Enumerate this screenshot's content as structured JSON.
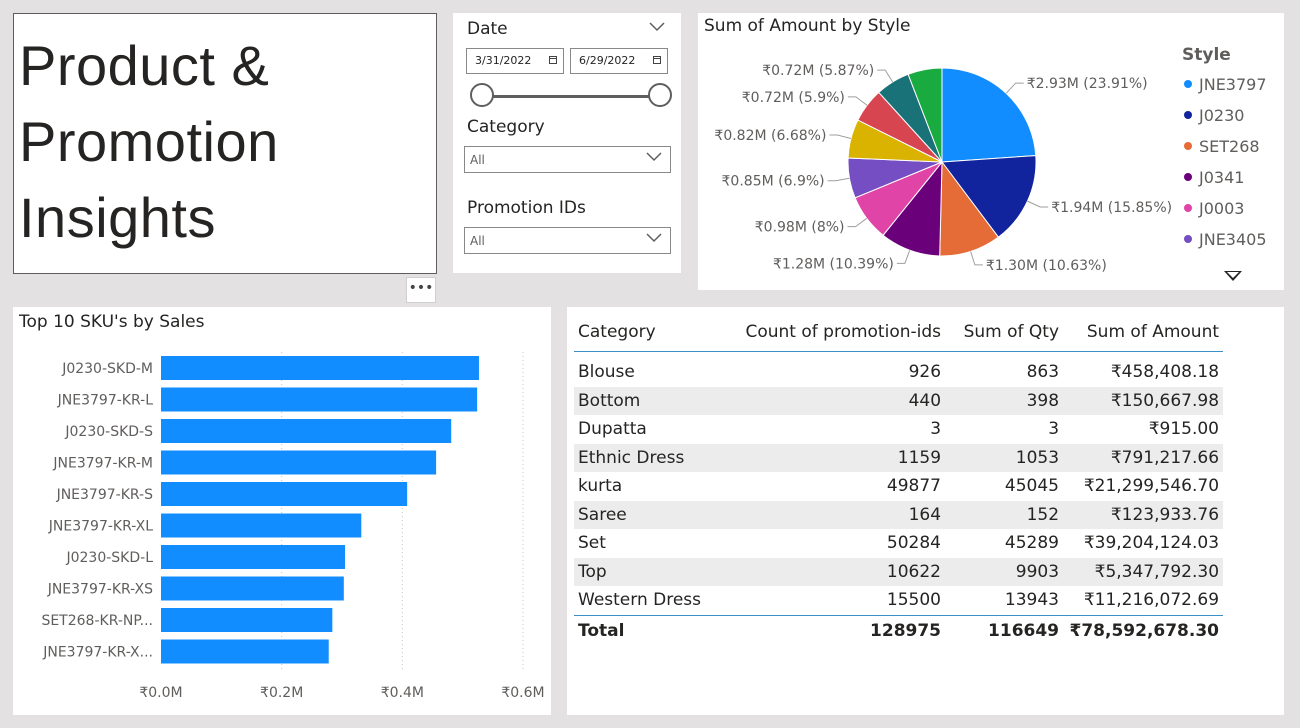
{
  "title_card": {
    "text": "Product  &\nPromotion\nInsights",
    "more_label": "•••"
  },
  "filters": {
    "date": {
      "label": "Date",
      "start": "3/31/2022",
      "end": "6/29/2022"
    },
    "category": {
      "label": "Category",
      "value": "All"
    },
    "promotion": {
      "label": "Promotion IDs",
      "value": "All"
    }
  },
  "pie": {
    "title": "Sum of Amount by Style",
    "legend_title": "Style",
    "legend": [
      {
        "name": "JNE3797",
        "color": "#118dff"
      },
      {
        "name": "J0230",
        "color": "#12239e"
      },
      {
        "name": "SET268",
        "color": "#e66c37"
      },
      {
        "name": "J0341",
        "color": "#6b007b"
      },
      {
        "name": "J0003",
        "color": "#e044a7"
      },
      {
        "name": "JNE3405",
        "color": "#744ec2"
      }
    ]
  },
  "chart_data": [
    {
      "type": "pie",
      "title": "Sum of Amount by Style",
      "slices": [
        {
          "name": "JNE3797",
          "value": 23.91,
          "label": "₹2.93M (23.91%)",
          "color": "#118dff"
        },
        {
          "name": "J0230",
          "value": 15.85,
          "label": "₹1.94M (15.85%)",
          "color": "#12239e"
        },
        {
          "name": "SET268",
          "value": 10.63,
          "label": "₹1.30M (10.63%)",
          "color": "#e66c37"
        },
        {
          "name": "J0341",
          "value": 10.39,
          "label": "₹1.28M (10.39%)",
          "color": "#6b007b"
        },
        {
          "name": "J0003",
          "value": 8.0,
          "label": "₹0.98M (8%)",
          "color": "#e044a7"
        },
        {
          "name": "JNE3405",
          "value": 6.9,
          "label": "₹0.85M (6.9%)",
          "color": "#744ec2"
        },
        {
          "name": "",
          "value": 6.68,
          "label": "₹0.82M (6.68%)",
          "color": "#d9b300"
        },
        {
          "name": "",
          "value": 5.9,
          "label": "₹0.72M (5.9%)",
          "color": "#d64550"
        },
        {
          "name": "",
          "value": 5.87,
          "label": "₹0.72M (5.87%)",
          "color": "#197278"
        },
        {
          "name": "",
          "value": 5.87,
          "label": "",
          "color": "#1aab40"
        }
      ]
    },
    {
      "type": "bar",
      "orientation": "horizontal",
      "title": "Top 10 SKU's by Sales",
      "categories": [
        "J0230-SKD-M",
        "JNE3797-KR-L",
        "J0230-SKD-S",
        "JNE3797-KR-M",
        "JNE3797-KR-S",
        "JNE3797-KR-XL",
        "J0230-SKD-L",
        "JNE3797-KR-XS",
        "SET268-KR-NP...",
        "JNE3797-KR-X..."
      ],
      "values": [
        0.527,
        0.524,
        0.481,
        0.456,
        0.408,
        0.332,
        0.305,
        0.303,
        0.284,
        0.278
      ],
      "xlim": [
        0,
        0.6
      ],
      "xticks": [
        "₹0.0M",
        "₹0.2M",
        "₹0.4M",
        "₹0.6M"
      ],
      "color": "#118dff"
    }
  ],
  "table": {
    "headers": [
      "Category",
      "Count of promotion-ids",
      "Sum of Qty",
      "Sum of Amount"
    ],
    "rows": [
      [
        "Blouse",
        "926",
        "863",
        "₹458,408.18"
      ],
      [
        "Bottom",
        "440",
        "398",
        "₹150,667.98"
      ],
      [
        "Dupatta",
        "3",
        "3",
        "₹915.00"
      ],
      [
        "Ethnic Dress",
        "1159",
        "1053",
        "₹791,217.66"
      ],
      [
        "kurta",
        "49877",
        "45045",
        "₹21,299,546.70"
      ],
      [
        "Saree",
        "164",
        "152",
        "₹123,933.76"
      ],
      [
        "Set",
        "50284",
        "45289",
        "₹39,204,124.03"
      ],
      [
        "Top",
        "10622",
        "9903",
        "₹5,347,792.30"
      ],
      [
        "Western Dress",
        "15500",
        "13943",
        "₹11,216,072.69"
      ]
    ],
    "total": [
      "Total",
      "128975",
      "116649",
      "₹78,592,678.30"
    ]
  }
}
